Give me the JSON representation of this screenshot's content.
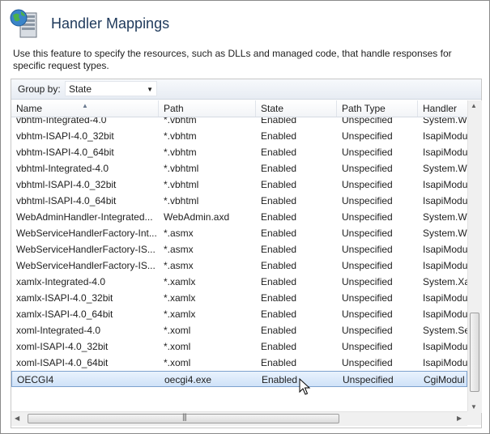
{
  "header": {
    "title": "Handler Mappings",
    "icon": "iis-globe-server-icon"
  },
  "description": "Use this feature to specify the resources, such as DLLs and managed code, that handle responses for specific request types.",
  "toolbar": {
    "group_by_label": "Group by:",
    "group_by_value": "State"
  },
  "table": {
    "columns": [
      "Name",
      "Path",
      "State",
      "Path Type",
      "Handler"
    ],
    "sort_column": "Name",
    "rows": [
      {
        "name": "vbhtm-Integrated-4.0",
        "path": "*.vbhtm",
        "state": "Enabled",
        "path_type": "Unspecified",
        "handler": "System.We"
      },
      {
        "name": "vbhtm-ISAPI-4.0_32bit",
        "path": "*.vbhtm",
        "state": "Enabled",
        "path_type": "Unspecified",
        "handler": "IsapiModu"
      },
      {
        "name": "vbhtm-ISAPI-4.0_64bit",
        "path": "*.vbhtm",
        "state": "Enabled",
        "path_type": "Unspecified",
        "handler": "IsapiModu"
      },
      {
        "name": "vbhtml-Integrated-4.0",
        "path": "*.vbhtml",
        "state": "Enabled",
        "path_type": "Unspecified",
        "handler": "System.We"
      },
      {
        "name": "vbhtml-ISAPI-4.0_32bit",
        "path": "*.vbhtml",
        "state": "Enabled",
        "path_type": "Unspecified",
        "handler": "IsapiModu"
      },
      {
        "name": "vbhtml-ISAPI-4.0_64bit",
        "path": "*.vbhtml",
        "state": "Enabled",
        "path_type": "Unspecified",
        "handler": "IsapiModu"
      },
      {
        "name": "WebAdminHandler-Integrated...",
        "path": "WebAdmin.axd",
        "state": "Enabled",
        "path_type": "Unspecified",
        "handler": "System.We"
      },
      {
        "name": "WebServiceHandlerFactory-Int...",
        "path": "*.asmx",
        "state": "Enabled",
        "path_type": "Unspecified",
        "handler": "System.We"
      },
      {
        "name": "WebServiceHandlerFactory-IS...",
        "path": "*.asmx",
        "state": "Enabled",
        "path_type": "Unspecified",
        "handler": "IsapiModu"
      },
      {
        "name": "WebServiceHandlerFactory-IS...",
        "path": "*.asmx",
        "state": "Enabled",
        "path_type": "Unspecified",
        "handler": "IsapiModu"
      },
      {
        "name": "xamlx-Integrated-4.0",
        "path": "*.xamlx",
        "state": "Enabled",
        "path_type": "Unspecified",
        "handler": "System.Xa"
      },
      {
        "name": "xamlx-ISAPI-4.0_32bit",
        "path": "*.xamlx",
        "state": "Enabled",
        "path_type": "Unspecified",
        "handler": "IsapiModu"
      },
      {
        "name": "xamlx-ISAPI-4.0_64bit",
        "path": "*.xamlx",
        "state": "Enabled",
        "path_type": "Unspecified",
        "handler": "IsapiModu"
      },
      {
        "name": "xoml-Integrated-4.0",
        "path": "*.xoml",
        "state": "Enabled",
        "path_type": "Unspecified",
        "handler": "System.Se"
      },
      {
        "name": "xoml-ISAPI-4.0_32bit",
        "path": "*.xoml",
        "state": "Enabled",
        "path_type": "Unspecified",
        "handler": "IsapiModu"
      },
      {
        "name": "xoml-ISAPI-4.0_64bit",
        "path": "*.xoml",
        "state": "Enabled",
        "path_type": "Unspecified",
        "handler": "IsapiModu"
      },
      {
        "name": "OECGI4",
        "path": "oecgi4.exe",
        "state": "Enabled",
        "path_type": "Unspecified",
        "handler": "CgiModul",
        "selected": true
      }
    ]
  },
  "colors": {
    "title": "#1e395b",
    "selection": "#cfe2f8",
    "selection_border": "#7da2ce"
  }
}
